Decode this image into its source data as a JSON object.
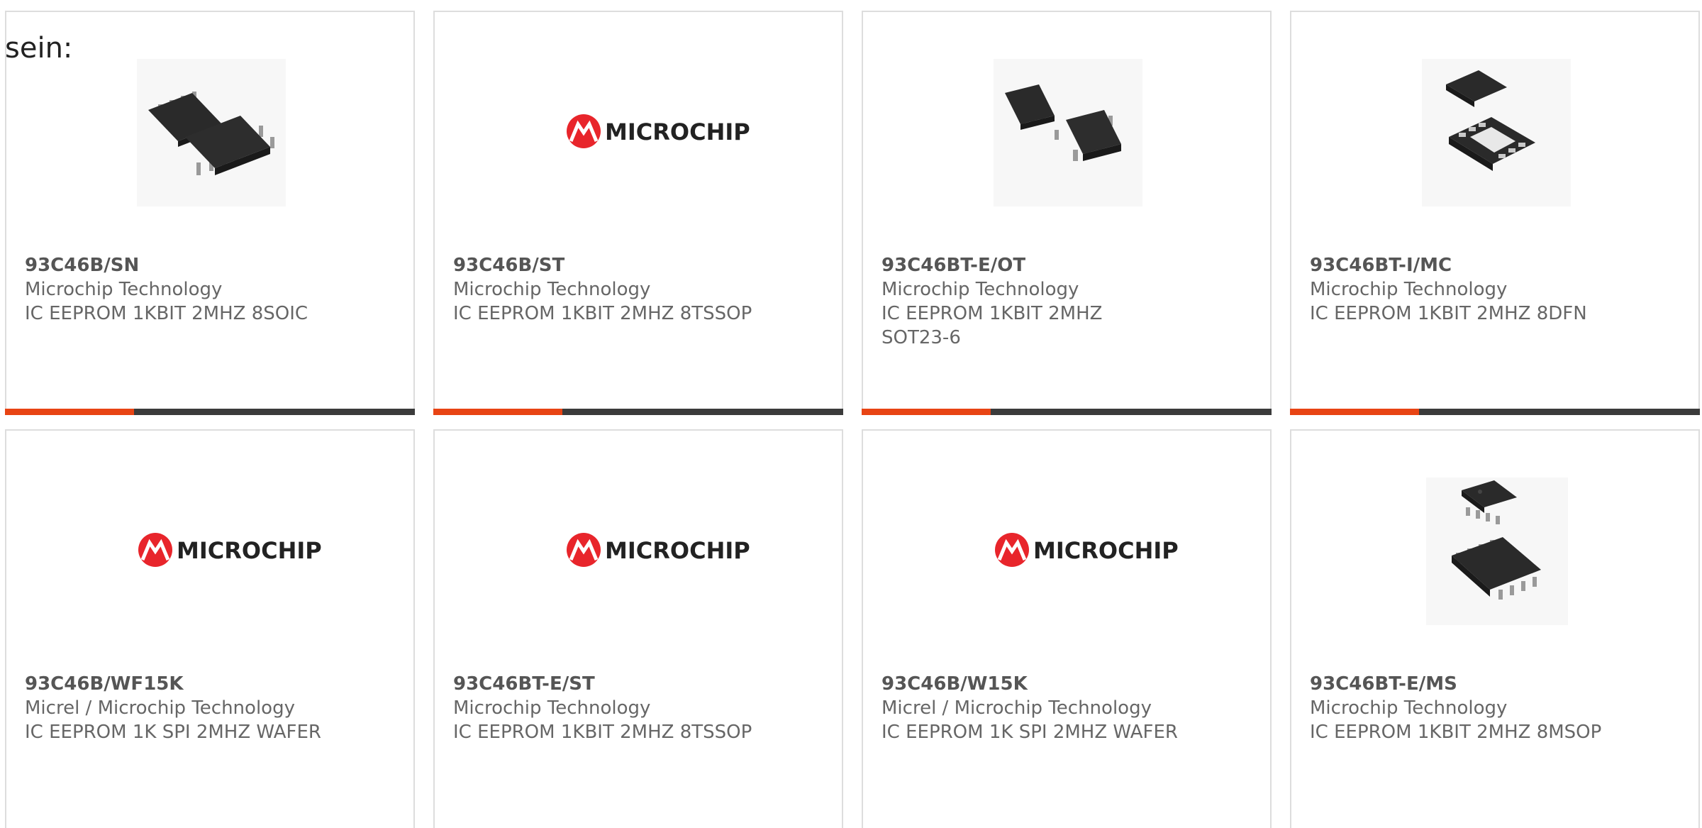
{
  "intro_text": "sein:",
  "colors": {
    "accent": "#e84414",
    "bar": "#3b3b3b",
    "border": "#dddddd",
    "microchip_red": "#e8252b"
  },
  "logo_text": "MICROCHIP",
  "products": [
    {
      "part": "93C46B/SN",
      "manufacturer": "Microchip Technology",
      "description": "IC EEPROM 1KBIT 2MHZ 8SOIC",
      "image": "soic8-chip-photo"
    },
    {
      "part": "93C46B/ST",
      "manufacturer": "Microchip Technology",
      "description": "IC EEPROM 1KBIT 2MHZ 8TSSOP",
      "image": "microchip-logo"
    },
    {
      "part": "93C46BT-E/OT",
      "manufacturer": "Microchip Technology",
      "description": "IC EEPROM 1KBIT 2MHZ SOT23-6",
      "image": "sot23-chip-photo"
    },
    {
      "part": "93C46BT-I/MC",
      "manufacturer": "Microchip Technology",
      "description": "IC EEPROM 1KBIT 2MHZ 8DFN",
      "image": "dfn8-chip-photo"
    },
    {
      "part": "93C46B/WF15K",
      "manufacturer": "Micrel / Microchip Technology",
      "description": "IC EEPROM 1K SPI 2MHZ WAFER",
      "image": "microchip-logo"
    },
    {
      "part": "93C46BT-E/ST",
      "manufacturer": "Microchip Technology",
      "description": "IC EEPROM 1KBIT 2MHZ 8TSSOP",
      "image": "microchip-logo"
    },
    {
      "part": "93C46B/W15K",
      "manufacturer": "Micrel / Microchip Technology",
      "description": "IC EEPROM 1K SPI 2MHZ WAFER",
      "image": "microchip-logo"
    },
    {
      "part": "93C46BT-E/MS",
      "manufacturer": "Microchip Technology",
      "description": "IC EEPROM 1KBIT 2MHZ 8MSOP",
      "image": "msop8-chip-photo"
    }
  ]
}
